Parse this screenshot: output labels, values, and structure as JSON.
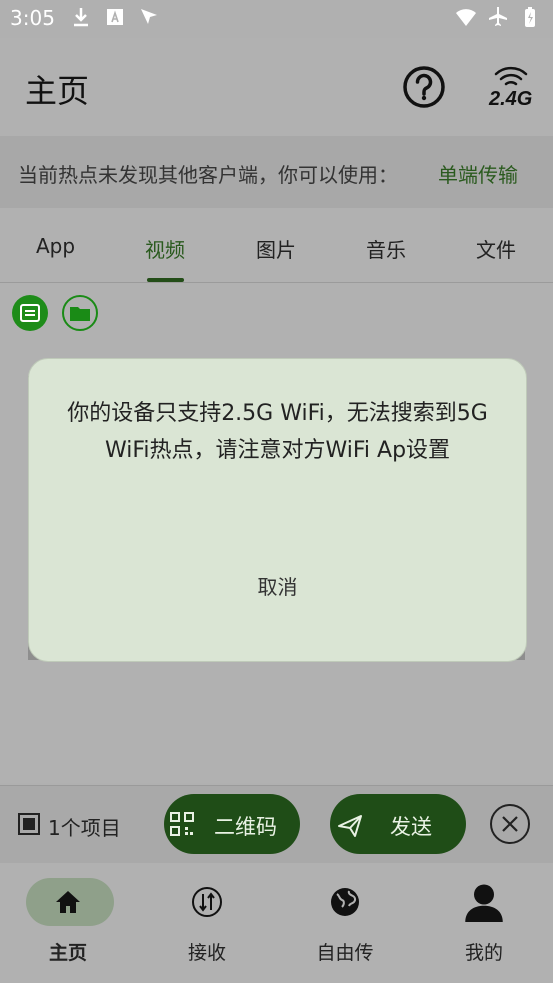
{
  "status": {
    "time": "3:05"
  },
  "header": {
    "title": "主页",
    "wifi_band": "2.4G"
  },
  "notice": {
    "message": "当前热点未发现其他客户端，你可以使用：",
    "link": "单端传输"
  },
  "tabs": [
    {
      "label": "App"
    },
    {
      "label": "视频"
    },
    {
      "label": "图片"
    },
    {
      "label": "音乐"
    },
    {
      "label": "文件"
    }
  ],
  "dialog": {
    "message": "你的设备只支持2.5G WiFi，无法搜索到5G WiFi热点，请注意对方WiFi Ap设置",
    "cancel": "取消"
  },
  "action": {
    "count": "1个项目",
    "qr_label": "二维码",
    "send_label": "发送"
  },
  "nav": [
    {
      "label": "主页",
      "icon": "home-icon"
    },
    {
      "label": "接收",
      "icon": "receive-icon"
    },
    {
      "label": "自由传",
      "icon": "globe-icon"
    },
    {
      "label": "我的",
      "icon": "person-icon"
    }
  ],
  "colors": {
    "accent": "#1f4d17",
    "dialog_bg": "#dae5d4",
    "scrim_bg": "#b1b1b1"
  }
}
